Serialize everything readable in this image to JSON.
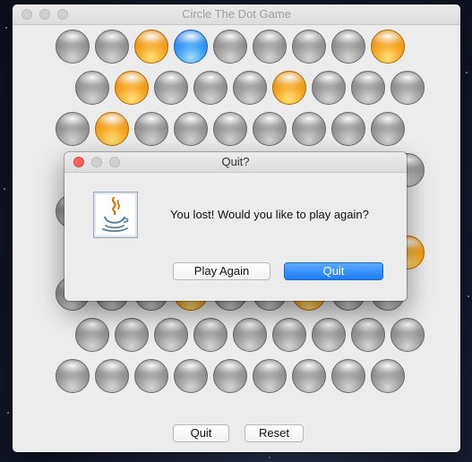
{
  "window": {
    "title": "Circle The Dot Game"
  },
  "board": {
    "rows": [
      [
        "gray",
        "gray",
        "orange",
        "blue",
        "gray",
        "gray",
        "gray",
        "gray",
        "orange"
      ],
      [
        "gray",
        "orange",
        "gray",
        "gray",
        "gray",
        "orange",
        "gray",
        "gray",
        "gray"
      ],
      [
        "gray",
        "orange",
        "gray",
        "gray",
        "gray",
        "gray",
        "gray",
        "gray",
        "gray"
      ],
      [
        "gray",
        "gray",
        "gray",
        "gray",
        "gray",
        "gray",
        "gray",
        "gray",
        "gray"
      ],
      [
        "gray",
        "gray",
        "gray",
        "gray",
        "gray",
        "gray",
        "gray",
        "gray",
        "gray"
      ],
      [
        "gray",
        "gray",
        "gray",
        "gray",
        "gray",
        "gray",
        "gray",
        "gray",
        "orange"
      ],
      [
        "gray",
        "gray",
        "gray",
        "orange",
        "gray",
        "gray",
        "orange",
        "gray",
        "gray"
      ],
      [
        "gray",
        "gray",
        "gray",
        "gray",
        "gray",
        "gray",
        "gray",
        "gray",
        "gray"
      ],
      [
        "gray",
        "gray",
        "gray",
        "gray",
        "gray",
        "gray",
        "gray",
        "gray",
        "gray"
      ]
    ],
    "colors": {
      "gray": "#9a9a9a",
      "orange": "#f5a623",
      "blue": "#3a9cf5"
    }
  },
  "controls": {
    "quit_label": "Quit",
    "reset_label": "Reset"
  },
  "dialog": {
    "title": "Quit?",
    "icon": "java-icon",
    "message": "You lost! Would you like to play again?",
    "play_again_label": "Play Again",
    "quit_label": "Quit"
  }
}
